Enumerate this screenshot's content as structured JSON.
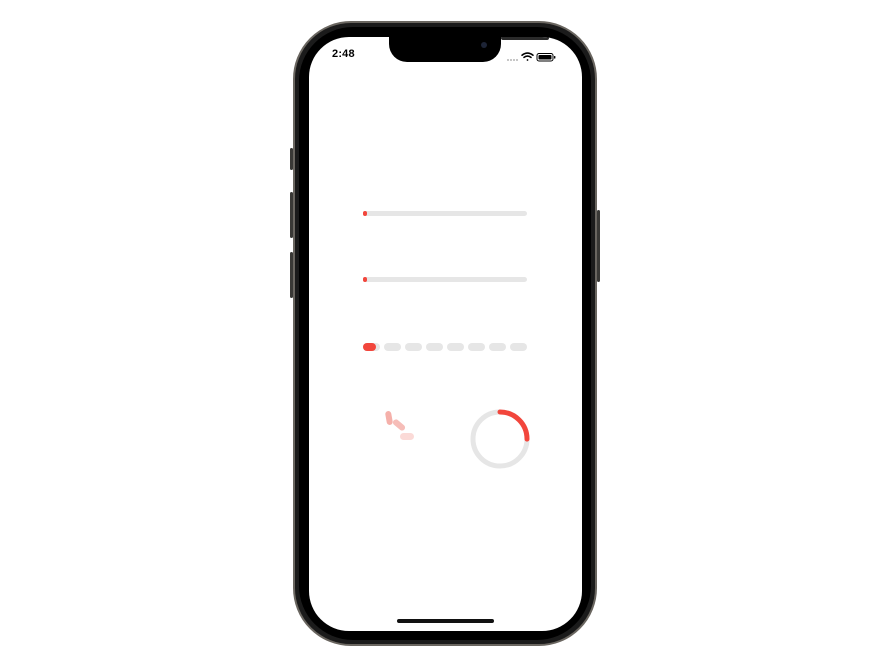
{
  "status_bar": {
    "time": "2:48"
  },
  "colors": {
    "accent": "#f2463c",
    "track": "#e6e6e6",
    "spinner": "#f5b5b0"
  },
  "progress_bars": [
    {
      "value": 0.02
    },
    {
      "value": 0.02
    }
  ],
  "segmented_progress": {
    "segments": 8,
    "active": 1,
    "partial": 0.6
  },
  "activity_indicator": {
    "icon": "spinner-icon"
  },
  "circular_progress": {
    "value": 0.25
  }
}
